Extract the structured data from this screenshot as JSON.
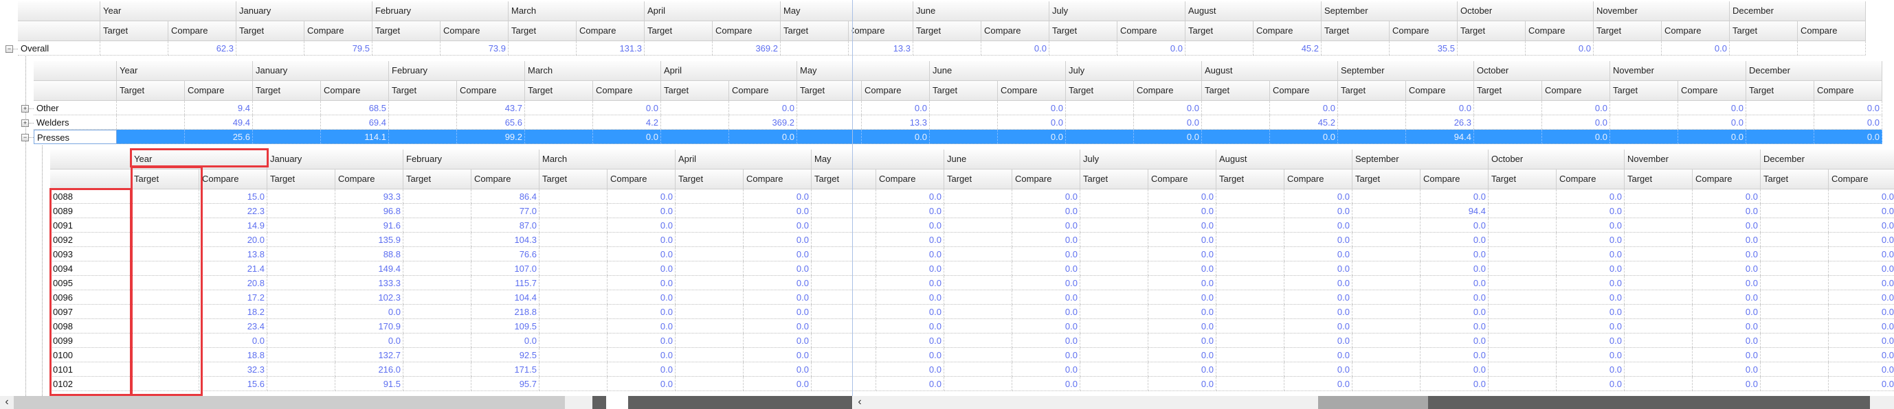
{
  "columns": {
    "groups": [
      "Year",
      "January",
      "February",
      "March",
      "April",
      "May",
      "June",
      "July",
      "August",
      "September",
      "October",
      "November",
      "December"
    ],
    "sub": [
      "Target",
      "Compare"
    ]
  },
  "overall": {
    "label": "Overall",
    "expanded": true,
    "compare": [
      "62.3",
      "79.5",
      "73.9",
      "131.3",
      "369.2",
      "13.3",
      "0.0",
      "0.0",
      "45.2",
      "35.5",
      "0.0",
      "0.0",
      null
    ]
  },
  "groups": [
    {
      "label": "Other",
      "expanded": false,
      "selected": false,
      "compare": [
        "9.4",
        "68.5",
        "43.7",
        "0.0",
        "0.0",
        "0.0",
        "0.0",
        "0.0",
        "0.0",
        "0.0",
        "0.0",
        "0.0",
        "0.0"
      ]
    },
    {
      "label": "Welders",
      "expanded": false,
      "selected": false,
      "compare": [
        "49.4",
        "69.4",
        "65.6",
        "4.2",
        "369.2",
        "13.3",
        "0.0",
        "0.0",
        "45.2",
        "26.3",
        "0.0",
        "0.0",
        "0.0"
      ]
    },
    {
      "label": "Presses",
      "expanded": true,
      "selected": true,
      "compare": [
        "25.6",
        "114.1",
        "99.2",
        "0.0",
        "0.0",
        "0.0",
        "0.0",
        "0.0",
        "0.0",
        "94.4",
        "0.0",
        "0.0",
        "0.0"
      ]
    }
  ],
  "details": [
    {
      "label": "0088",
      "compare": [
        "15.0",
        "93.3",
        "86.4",
        "0.0",
        "0.0",
        "0.0",
        "0.0",
        "0.0",
        "0.0",
        "0.0",
        "0.0",
        "0.0",
        "0.0"
      ]
    },
    {
      "label": "0089",
      "compare": [
        "22.3",
        "96.8",
        "77.0",
        "0.0",
        "0.0",
        "0.0",
        "0.0",
        "0.0",
        "0.0",
        "94.4",
        "0.0",
        "0.0",
        "0.0"
      ]
    },
    {
      "label": "0091",
      "compare": [
        "14.9",
        "91.6",
        "87.0",
        "0.0",
        "0.0",
        "0.0",
        "0.0",
        "0.0",
        "0.0",
        "0.0",
        "0.0",
        "0.0",
        "0.0"
      ]
    },
    {
      "label": "0092",
      "compare": [
        "20.0",
        "135.9",
        "104.3",
        "0.0",
        "0.0",
        "0.0",
        "0.0",
        "0.0",
        "0.0",
        "0.0",
        "0.0",
        "0.0",
        "0.0"
      ]
    },
    {
      "label": "0093",
      "compare": [
        "13.8",
        "88.8",
        "76.6",
        "0.0",
        "0.0",
        "0.0",
        "0.0",
        "0.0",
        "0.0",
        "0.0",
        "0.0",
        "0.0",
        "0.0"
      ]
    },
    {
      "label": "0094",
      "compare": [
        "21.4",
        "149.4",
        "107.0",
        "0.0",
        "0.0",
        "0.0",
        "0.0",
        "0.0",
        "0.0",
        "0.0",
        "0.0",
        "0.0",
        "0.0"
      ]
    },
    {
      "label": "0095",
      "compare": [
        "20.8",
        "133.3",
        "115.7",
        "0.0",
        "0.0",
        "0.0",
        "0.0",
        "0.0",
        "0.0",
        "0.0",
        "0.0",
        "0.0",
        "0.0"
      ]
    },
    {
      "label": "0096",
      "compare": [
        "17.2",
        "102.3",
        "104.4",
        "0.0",
        "0.0",
        "0.0",
        "0.0",
        "0.0",
        "0.0",
        "0.0",
        "0.0",
        "0.0",
        "0.0"
      ]
    },
    {
      "label": "0097",
      "compare": [
        "18.2",
        "0.0",
        "218.8",
        "0.0",
        "0.0",
        "0.0",
        "0.0",
        "0.0",
        "0.0",
        "0.0",
        "0.0",
        "0.0",
        "0.0"
      ]
    },
    {
      "label": "0098",
      "compare": [
        "23.4",
        "170.9",
        "109.5",
        "0.0",
        "0.0",
        "0.0",
        "0.0",
        "0.0",
        "0.0",
        "0.0",
        "0.0",
        "0.0",
        "0.0"
      ]
    },
    {
      "label": "0099",
      "compare": [
        "0.0",
        "0.0",
        "0.0",
        "0.0",
        "0.0",
        "0.0",
        "0.0",
        "0.0",
        "0.0",
        "0.0",
        "0.0",
        "0.0",
        "0.0"
      ]
    },
    {
      "label": "0100",
      "compare": [
        "18.8",
        "132.7",
        "92.5",
        "0.0",
        "0.0",
        "0.0",
        "0.0",
        "0.0",
        "0.0",
        "0.0",
        "0.0",
        "0.0",
        "0.0"
      ]
    },
    {
      "label": "0101",
      "compare": [
        "32.3",
        "216.0",
        "171.5",
        "0.0",
        "0.0",
        "0.0",
        "0.0",
        "0.0",
        "0.0",
        "0.0",
        "0.0",
        "0.0",
        "0.0"
      ]
    },
    {
      "label": "0102",
      "compare": [
        "15.6",
        "91.5",
        "95.7",
        "0.0",
        "0.0",
        "0.0",
        "0.0",
        "0.0",
        "0.0",
        "0.0",
        "0.0",
        "0.0",
        "0.0"
      ]
    }
  ],
  "icons": {
    "expanded": "minus-box-icon",
    "collapsed": "plus-box-icon",
    "scroll_left": "chevron-left-icon"
  },
  "glyphs": {
    "minus": "−",
    "plus": "+",
    "left": "‹"
  },
  "colors": {
    "selection": "#3399ff",
    "value_text": "#5d6ff0",
    "highlight_box": "#e8383d"
  }
}
